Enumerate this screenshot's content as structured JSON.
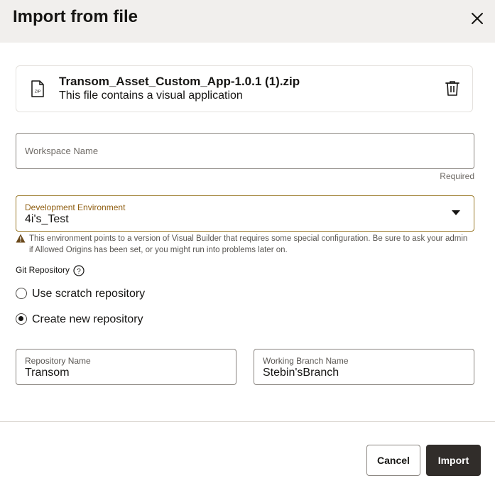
{
  "dialog": {
    "title": "Import from file",
    "close_icon": "close-icon"
  },
  "file": {
    "name": "Transom_Asset_Custom_App-1.0.1 (1).zip",
    "description": "This file contains a visual application",
    "icon": "zip-file-icon",
    "icon_text": "ZIP",
    "delete_icon": "trash-icon"
  },
  "workspace": {
    "placeholder": "Workspace Name",
    "required": "Required"
  },
  "environment": {
    "label": "Development Environment",
    "value": "4i's_Test",
    "warning": "This environment points to a version of Visual Builder that requires some special configuration. Be sure to ask your admin if Allowed Origins has been set, or you might run into problems later on."
  },
  "git": {
    "label": "Git Repository",
    "help_icon": "help-icon",
    "options": [
      {
        "label": "Use scratch repository",
        "selected": false
      },
      {
        "label": "Create new repository",
        "selected": true
      }
    ]
  },
  "repository": {
    "name_label": "Repository Name",
    "name_value": "Transom",
    "branch_label": "Working Branch Name",
    "branch_value": "Stebin'sBranch"
  },
  "footer": {
    "cancel_label": "Cancel",
    "import_label": "Import"
  },
  "colors": {
    "header_bg": "#f1efed",
    "primary_button": "#312d2a",
    "env_label": "#8f5e11",
    "warning_icon": "#6b4a1c"
  }
}
